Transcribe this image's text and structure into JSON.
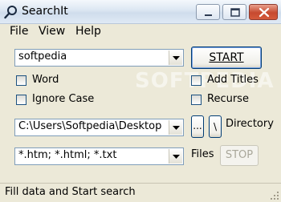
{
  "window": {
    "title": "SearchIt"
  },
  "menu": [
    "File",
    "View",
    "Help"
  ],
  "search": {
    "value": "softpedia"
  },
  "start_button": {
    "label": "START",
    "access_key_index": 0
  },
  "options": {
    "word": {
      "label": "Word",
      "checked": false
    },
    "ignore_case": {
      "label": "Ignore Case",
      "checked": false
    },
    "add_titles": {
      "label": "Add Titles",
      "checked": false
    },
    "recurse": {
      "label": "Recurse",
      "checked": false
    }
  },
  "directory": {
    "value": "C:\\Users\\Softpedia\\Desktop",
    "browse_label": "...",
    "root_label": "\\",
    "label": "Directory"
  },
  "files": {
    "value": "*.htm; *.html; *.txt",
    "label": "Files"
  },
  "stop_button": {
    "label": "STOP",
    "enabled": false
  },
  "status": {
    "text": "Fill data and Start search"
  },
  "watermark": "SOFTPEDIA",
  "colors": {
    "titlebar": "#dbe6f2",
    "close_button": "#c64a2f",
    "field_border": "#7f9db9",
    "face": "#ece9d8"
  }
}
